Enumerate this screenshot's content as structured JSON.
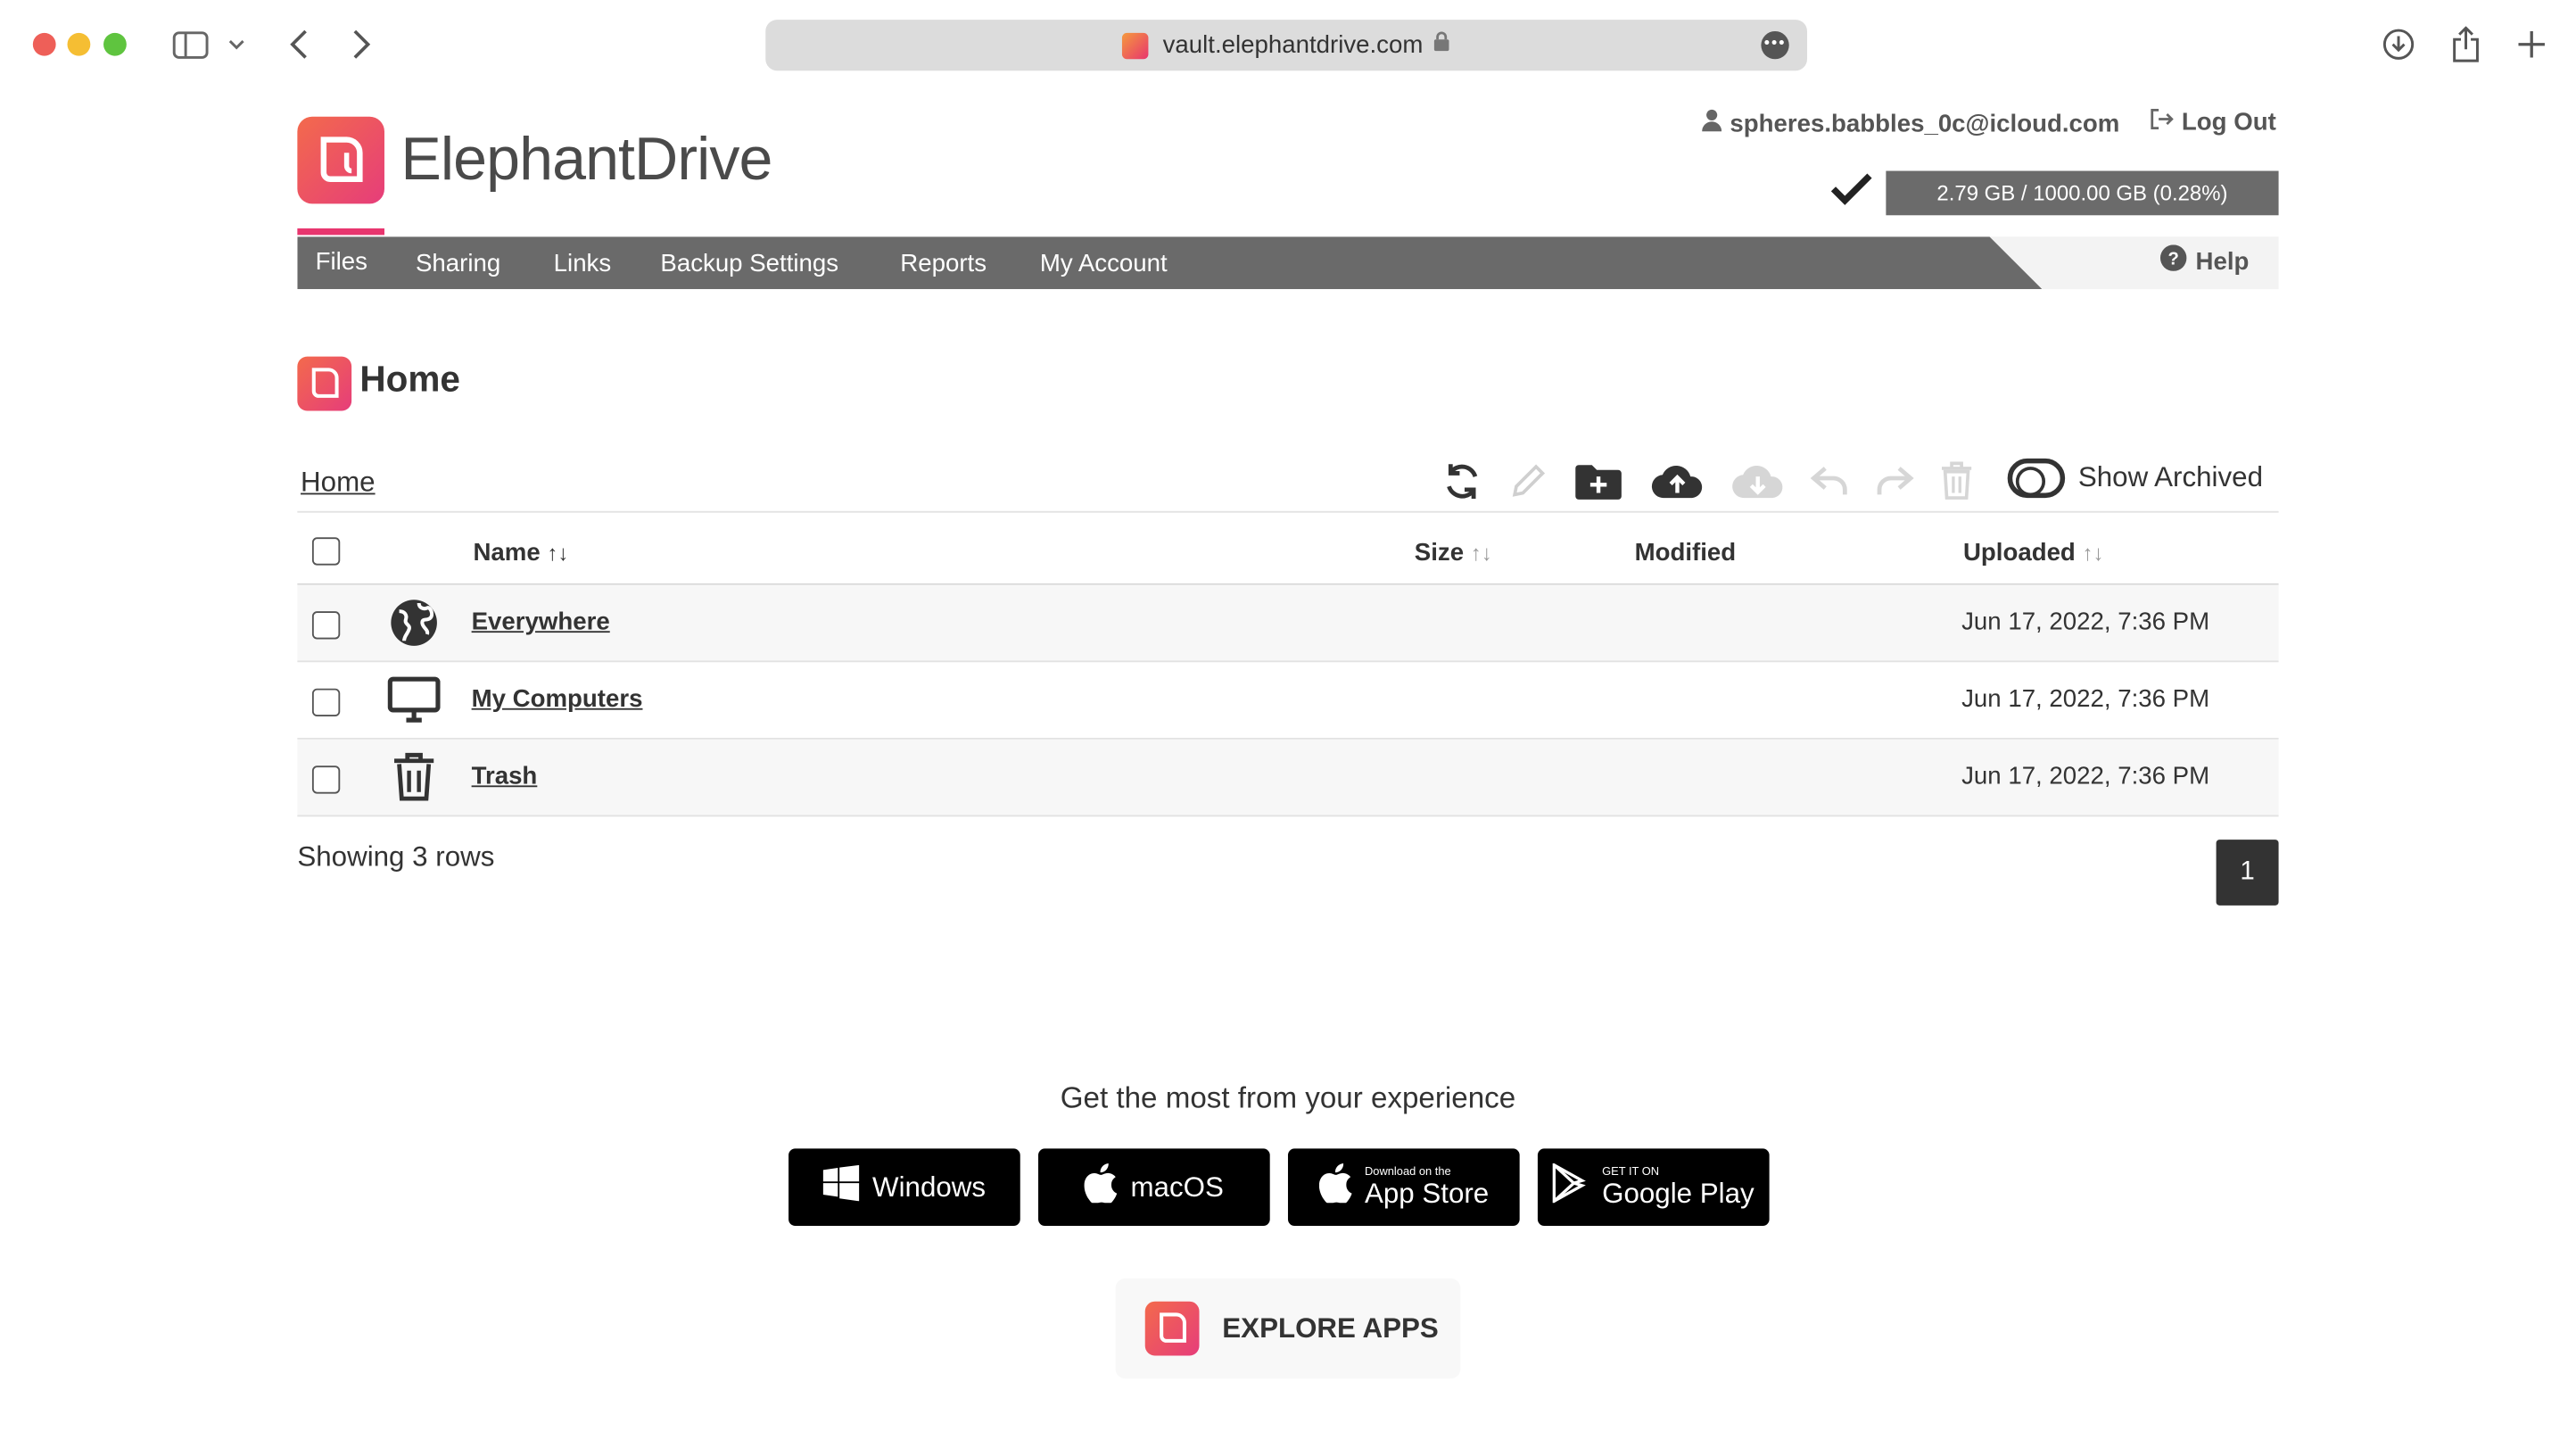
{
  "browser": {
    "url": "vault.elephantdrive.com"
  },
  "header": {
    "brand": "ElephantDrive",
    "user_email": "spheres.babbles_0c@icloud.com",
    "logout_label": "Log Out",
    "quota": "2.79 GB / 1000.00 GB (0.28%)",
    "help_label": "Help"
  },
  "nav": {
    "items": [
      {
        "label": "Files"
      },
      {
        "label": "Sharing"
      },
      {
        "label": "Links"
      },
      {
        "label": "Backup Settings"
      },
      {
        "label": "Reports"
      },
      {
        "label": "My Account"
      }
    ]
  },
  "main": {
    "title": "Home",
    "breadcrumb": "Home",
    "show_archived_label": "Show Archived",
    "columns": {
      "name": "Name",
      "size": "Size",
      "modified": "Modified",
      "uploaded": "Uploaded",
      "sort_glyph": "↑↓"
    },
    "rows": [
      {
        "icon": "globe-icon",
        "name": "Everywhere",
        "uploaded": "Jun 17, 2022, 7:36 PM"
      },
      {
        "icon": "monitor-icon",
        "name": "My Computers",
        "uploaded": "Jun 17, 2022, 7:36 PM"
      },
      {
        "icon": "trash-icon",
        "name": "Trash",
        "uploaded": "Jun 17, 2022, 7:36 PM"
      }
    ],
    "showing": "Showing 3 rows",
    "page": "1"
  },
  "promo": {
    "heading": "Get the most from your experience",
    "windows": "Windows",
    "macos": "macOS",
    "appstore_small": "Download on the",
    "appstore_big": "App Store",
    "gplay_small": "GET IT ON",
    "gplay_big": "Google Play",
    "explore": "EXPLORE APPS"
  }
}
